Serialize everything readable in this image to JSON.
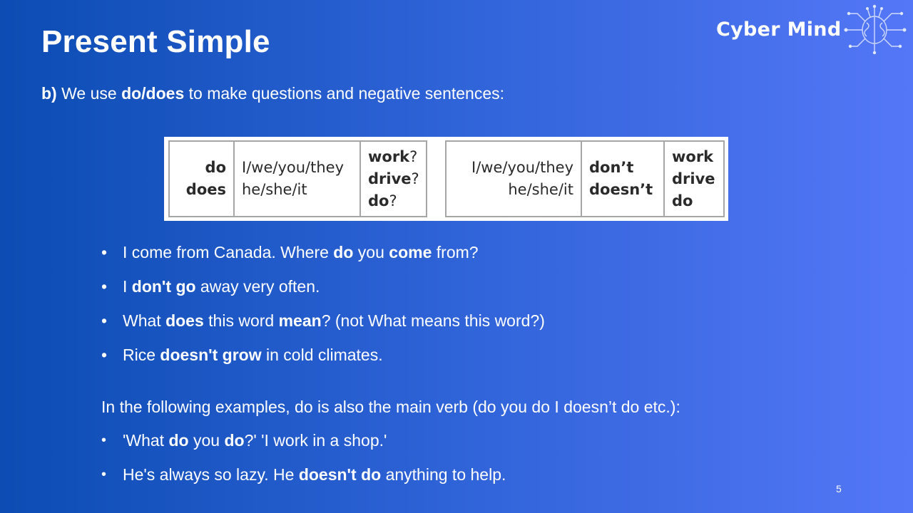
{
  "title": "Present Simple",
  "subtitle": {
    "lead": "b)",
    "pre": " We use ",
    "bold": "do/does",
    "post": " to make questions and negative sentences:"
  },
  "logo": {
    "text": "Cyber Mind",
    "icon": "brain-circuit-icon"
  },
  "grammar_table": {
    "questions": {
      "aux": [
        "do",
        "does"
      ],
      "subjects": [
        "I/we/you/they",
        "he/she/it"
      ],
      "verbs": [
        "work",
        "drive",
        "do"
      ],
      "verb_suffix": "?"
    },
    "negatives": {
      "subjects": [
        "I/we/you/they",
        "he/she/it"
      ],
      "aux": [
        "don’t",
        "doesn’t"
      ],
      "verbs": [
        "work",
        "drive",
        "do"
      ]
    }
  },
  "bullets": [
    [
      {
        "t": "I come from Canada. Where ",
        "b": false
      },
      {
        "t": "do",
        "b": true
      },
      {
        "t": " you ",
        "b": false
      },
      {
        "t": "come",
        "b": true
      },
      {
        "t": " from?",
        "b": false
      }
    ],
    [
      {
        "t": "I ",
        "b": false
      },
      {
        "t": "don't go",
        "b": true
      },
      {
        "t": " away very often.",
        "b": false
      }
    ],
    [
      {
        "t": "What ",
        "b": false
      },
      {
        "t": "does",
        "b": true
      },
      {
        "t": " this word ",
        "b": false
      },
      {
        "t": "mean",
        "b": true
      },
      {
        "t": "? (not What means this word?)",
        "b": false
      }
    ],
    [
      {
        "t": "Rice ",
        "b": false
      },
      {
        "t": "doesn't grow",
        "b": true
      },
      {
        "t": " in cold climates.",
        "b": false
      }
    ]
  ],
  "paragraph": "In the following examples, do is also the main verb (do you do I doesn’t do etc.):",
  "bullets2": [
    [
      {
        "t": "'What ",
        "b": false
      },
      {
        "t": "do",
        "b": true
      },
      {
        "t": " you ",
        "b": false
      },
      {
        "t": "do",
        "b": true
      },
      {
        "t": "?' 'I work in a shop.'",
        "b": false
      }
    ],
    [
      {
        "t": "He's always so lazy. He ",
        "b": false
      },
      {
        "t": "doesn't do",
        "b": true
      },
      {
        "t": " anything to help.",
        "b": false
      }
    ]
  ],
  "page_number": "5"
}
